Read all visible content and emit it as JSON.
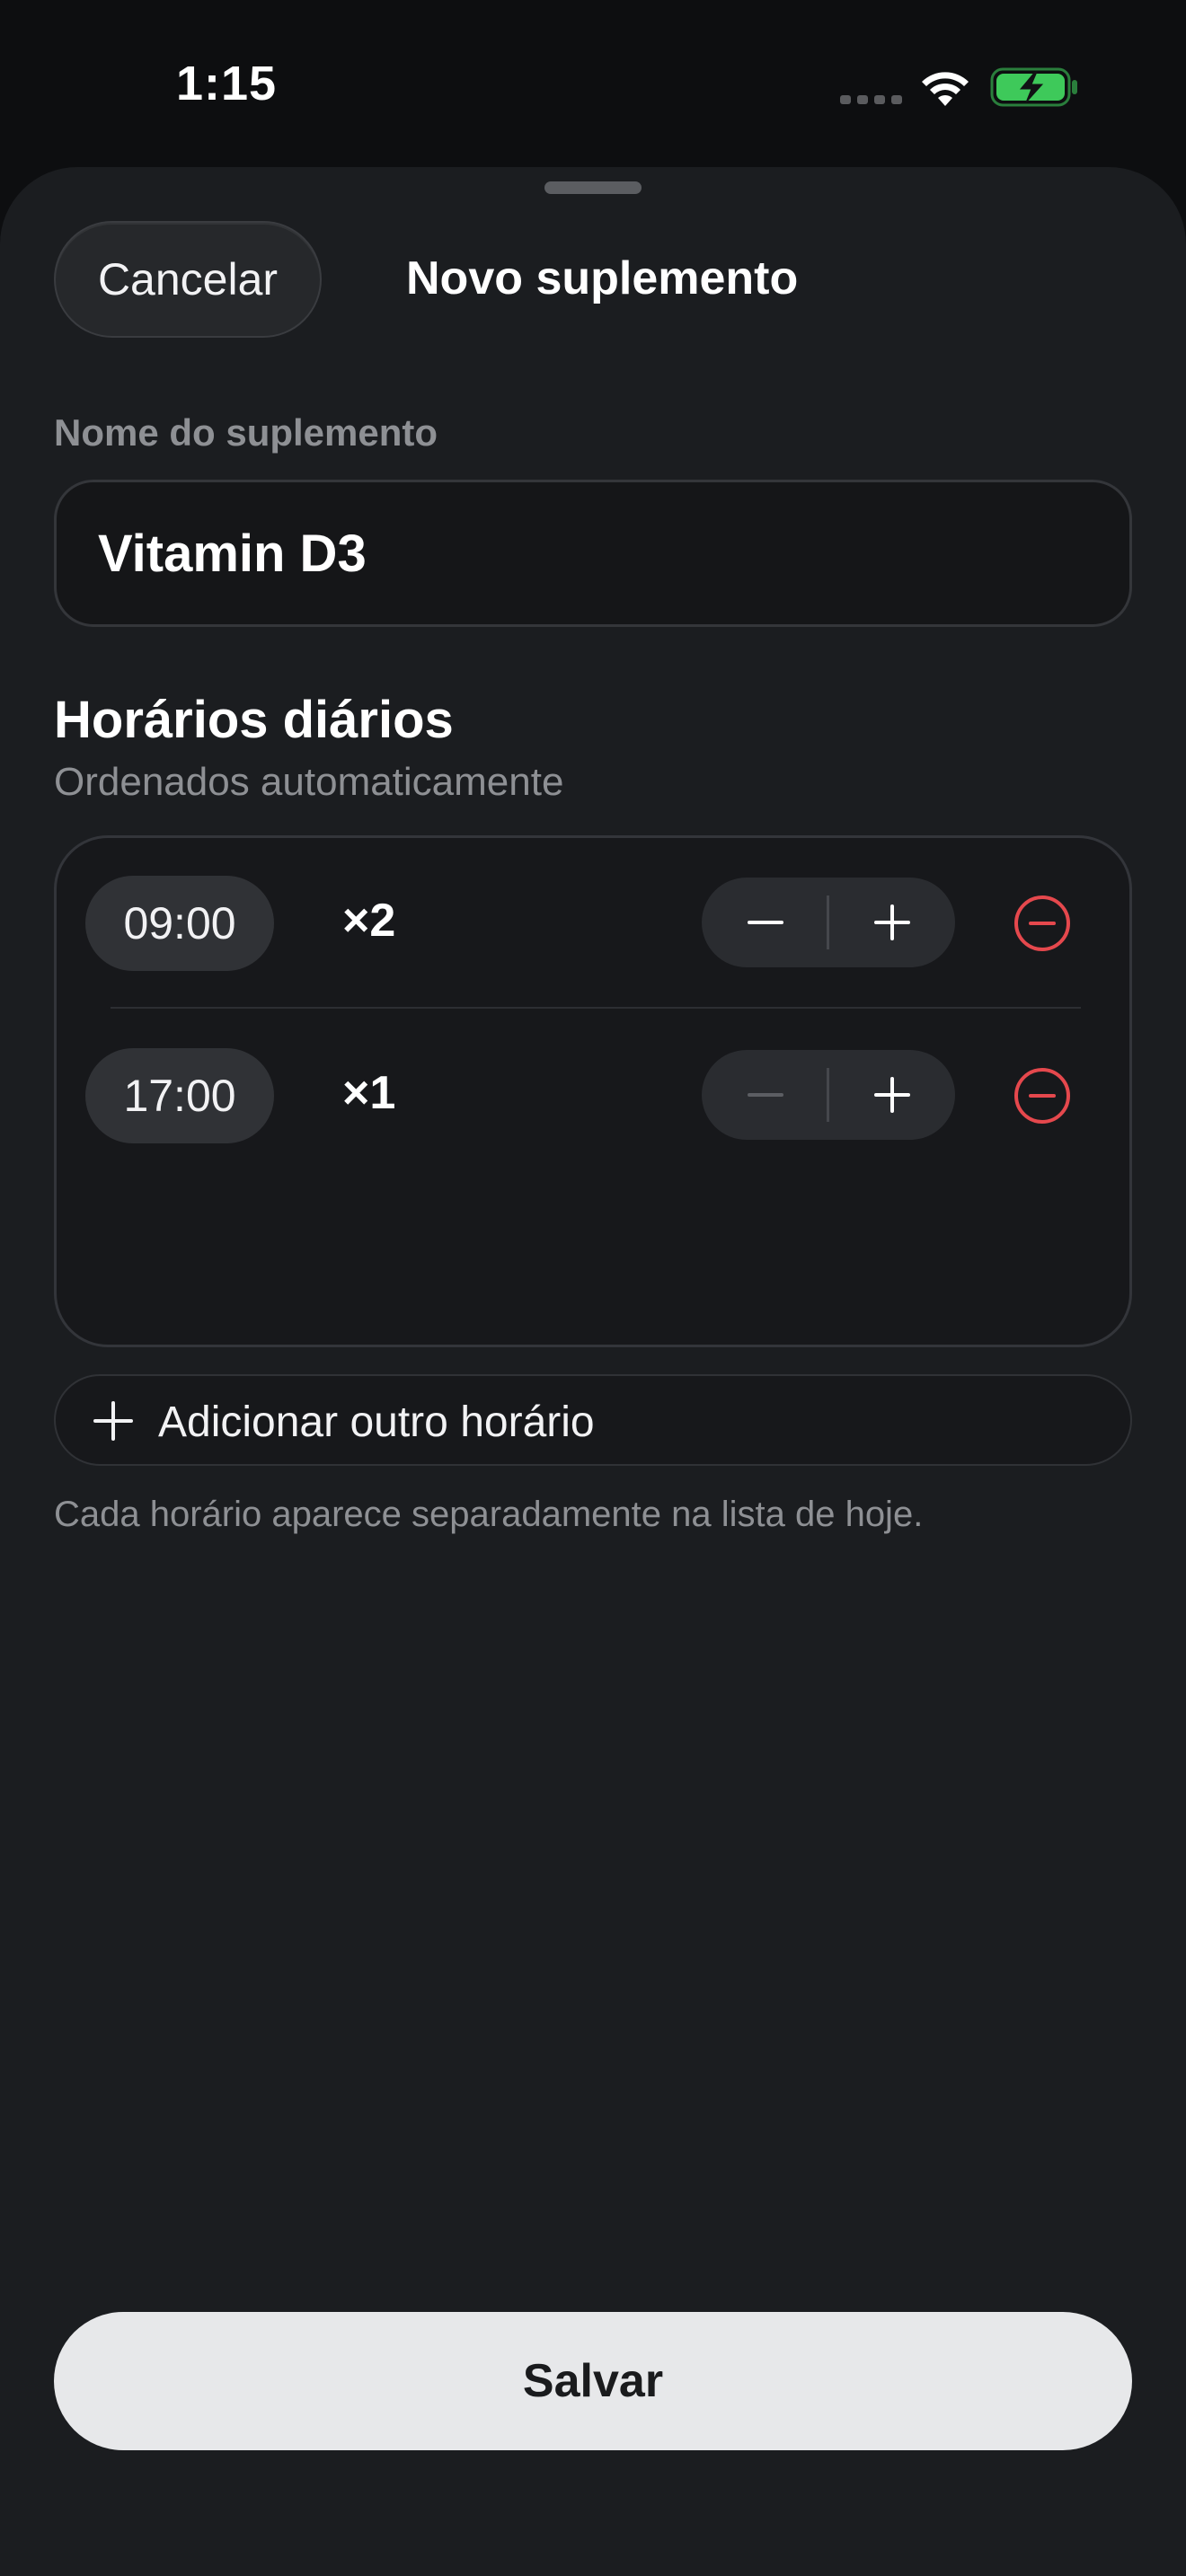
{
  "status_bar": {
    "time": "1:15"
  },
  "sheet": {
    "cancel_label": "Cancelar",
    "title": "Novo suplemento"
  },
  "form": {
    "name_label": "Nome do suplemento",
    "name_value": "Vitamin D3"
  },
  "schedule": {
    "title": "Horários diários",
    "subtitle": "Ordenados automaticamente",
    "rows": [
      {
        "time": "09:00",
        "quantity": "×2",
        "minus_enabled": true
      },
      {
        "time": "17:00",
        "quantity": "×1",
        "minus_enabled": false
      }
    ],
    "add_label": "Adicionar outro horário",
    "helper": "Cada horário aparece separadamente na lista de hoje."
  },
  "save_label": "Salvar",
  "colors": {
    "sheet_background": "#1b1d20",
    "battery_green": "#3ec95a",
    "remove_red": "#e5484d",
    "save_background": "#e7e8ea"
  },
  "icons": {
    "wifi": "wifi-icon",
    "battery": "battery-charging-icon",
    "minus": "minus-icon",
    "plus": "plus-icon",
    "remove": "minus-circle-icon",
    "add": "plus-icon"
  }
}
